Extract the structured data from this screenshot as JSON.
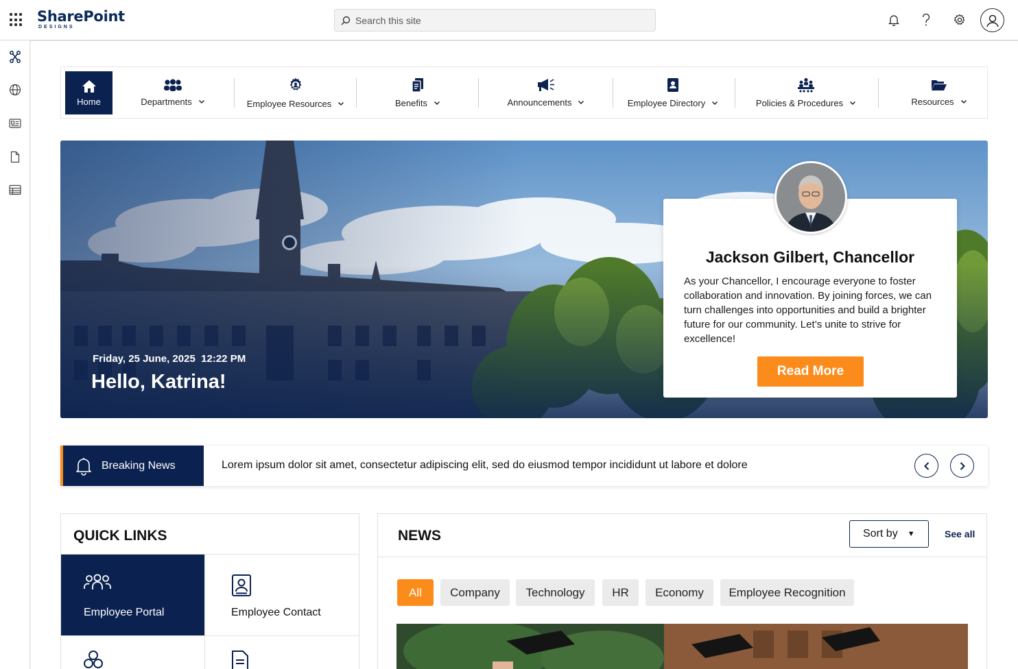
{
  "header": {
    "logo_text": "SharePoint",
    "logo_subtext": "DESIGNS",
    "search_placeholder": "Search this site"
  },
  "rail": {
    "icons": [
      "hub-icon",
      "globe-icon",
      "news-icon",
      "document-icon",
      "list-icon"
    ]
  },
  "nav": {
    "home_label": "Home",
    "items": [
      {
        "label": "Departments",
        "icon": "people-group-icon"
      },
      {
        "label": "Employee Resources",
        "icon": "gear-person-icon"
      },
      {
        "label": "Benefits",
        "icon": "documents-icon"
      },
      {
        "label": "Announcements",
        "icon": "megaphone-icon"
      },
      {
        "label": "Employee Directory",
        "icon": "contact-book-icon"
      },
      {
        "label": "Policies & Procedures",
        "icon": "meeting-icon"
      },
      {
        "label": "Resources",
        "icon": "folder-open-icon"
      }
    ]
  },
  "hero": {
    "date": "Friday, 25 June, 2025",
    "time": "12:22 PM",
    "greeting": "Hello, Katrina!",
    "card": {
      "name": "Jackson Gilbert, Chancellor",
      "message": "As your Chancellor, I encourage everyone to foster collaboration and innovation. By joining forces, we can turn challenges into opportunities and build a brighter future for our community. Let’s unite to strive for excellence!",
      "button_label": "Read More"
    }
  },
  "breaking_news": {
    "label": "Breaking News",
    "text": "Lorem ipsum dolor sit amet, consectetur adipiscing elit, sed do eiusmod tempor incididunt ut labore et dolore"
  },
  "quick_links": {
    "title": "QUICK LINKS",
    "items": [
      {
        "label": "Employee Portal",
        "icon": "people-icon"
      },
      {
        "label": "Employee Contact",
        "icon": "contact-card-icon"
      }
    ]
  },
  "news": {
    "title": "NEWS",
    "sort_label": "Sort by",
    "see_all_label": "See all",
    "filters": [
      "All",
      "Company",
      "Technology",
      "HR",
      "Economy",
      "Employee Recognition"
    ],
    "active_filter": "All"
  },
  "colors": {
    "navy": "#0b2250",
    "accent_orange": "#fb8c1c"
  }
}
